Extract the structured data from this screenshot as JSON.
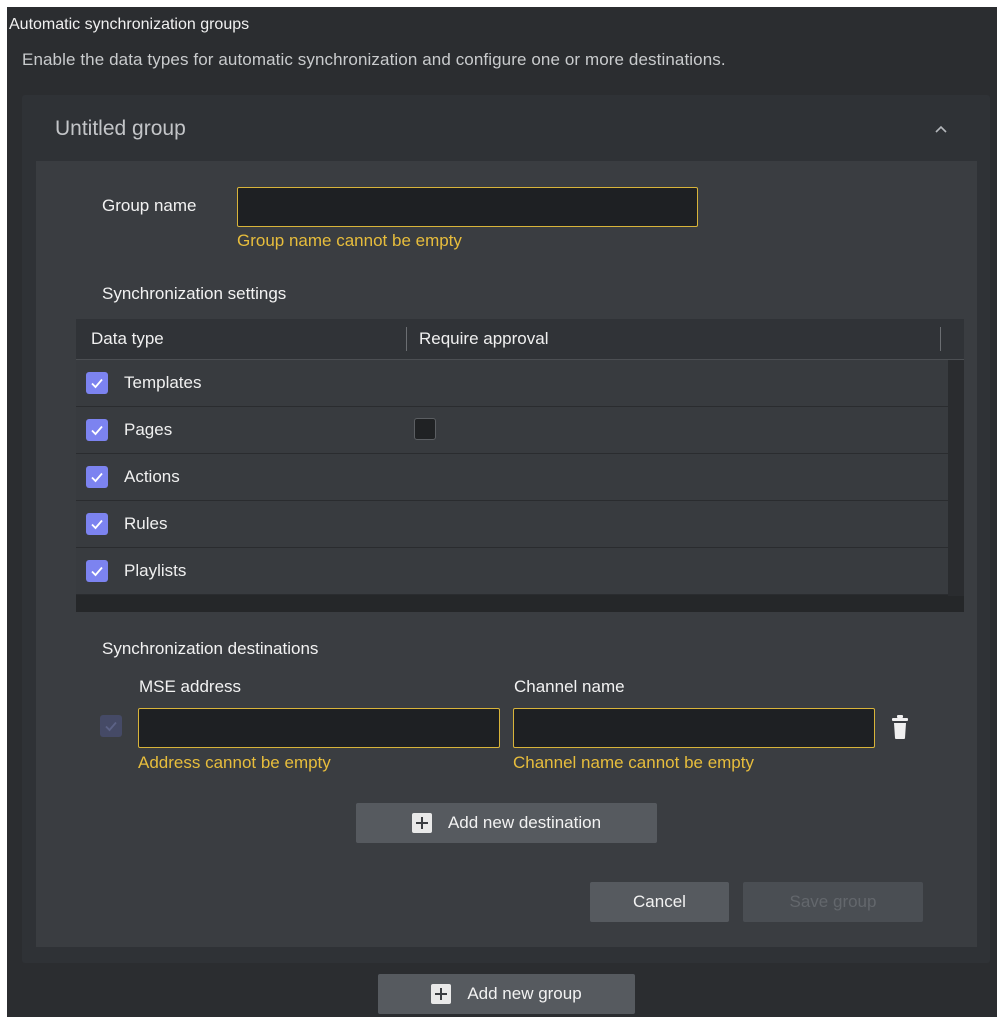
{
  "header": {
    "title": "Automatic synchronization groups",
    "subtitle": "Enable the data types for automatic synchronization and configure one or more destinations."
  },
  "group": {
    "title": "Untitled group",
    "collapse_icon": "chevron-up-icon",
    "name_label": "Group name",
    "name_value": "",
    "name_error": "Group name cannot be empty",
    "settings_label": "Synchronization settings",
    "table": {
      "columns": [
        "Data type",
        "Require approval"
      ],
      "rows": [
        {
          "label": "Templates",
          "enabled": true,
          "require_approval": null
        },
        {
          "label": "Pages",
          "enabled": true,
          "require_approval": false
        },
        {
          "label": "Actions",
          "enabled": true,
          "require_approval": null
        },
        {
          "label": "Rules",
          "enabled": true,
          "require_approval": null
        },
        {
          "label": "Playlists",
          "enabled": true,
          "require_approval": null
        }
      ]
    },
    "destinations_label": "Synchronization destinations",
    "destination": {
      "address_label": "MSE address",
      "channel_label": "Channel name",
      "address_value": "",
      "channel_value": "",
      "address_error": "Address cannot be empty",
      "channel_error": "Channel name cannot be empty",
      "enabled": true,
      "delete_icon": "trash-icon"
    },
    "add_destination_label": "Add new destination",
    "cancel_label": "Cancel",
    "save_label": "Save group"
  },
  "add_group_label": "Add new group",
  "colors": {
    "background": "#2b2d30",
    "accent_checkbox": "#7c83f0",
    "error": "#e7bd3c",
    "button": "#565a5f"
  }
}
